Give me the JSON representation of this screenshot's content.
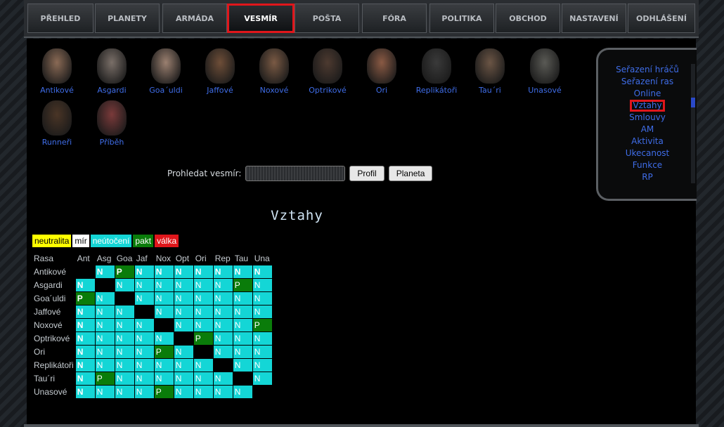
{
  "nav": {
    "items": [
      "PŘEHLED",
      "PLANETY",
      "ARMÁDA",
      "VESMÍR",
      "POŠTA",
      "FÓRA",
      "POLITIKA",
      "OBCHOD",
      "NASTAVENÍ",
      "ODHLÁŠENÍ"
    ],
    "active_index": 3
  },
  "races_row1": [
    "Antikové",
    "Asgardi",
    "Goa´uldi",
    "Jaffové",
    "Noxové",
    "Optrikové",
    "Ori",
    "Replikátoři",
    "Tau´ri",
    "Unasové"
  ],
  "races_row2": [
    "Runneři",
    "Příběh"
  ],
  "search": {
    "label": "Prohledat vesmír:",
    "profil": "Profil",
    "planeta": "Planeta"
  },
  "sidebar": {
    "links": [
      "Seřazení hráčů",
      "Seřazení ras",
      "Online",
      "Vztahy",
      "Smlouvy",
      "AM",
      "Aktivita",
      "Ukecanost",
      "Funkce",
      "RP"
    ],
    "active": "Vztahy"
  },
  "title": "Vztahy",
  "legend": [
    {
      "label": "neutralita",
      "bg": "#ffff00",
      "fg": "#000000"
    },
    {
      "label": "mír",
      "bg": "#ffffff",
      "fg": "#000000"
    },
    {
      "label": "neútočení",
      "bg": "#14d6d6",
      "fg": "#ffffff"
    },
    {
      "label": "pakt",
      "bg": "#0a7c0a",
      "fg": "#ffffff"
    },
    {
      "label": "válka",
      "bg": "#e0161b",
      "fg": "#ffffff"
    }
  ],
  "table": {
    "corner": "Rasa",
    "cols": [
      "Ant",
      "Asg",
      "Goa",
      "Jaf",
      "Nox",
      "Opt",
      "Ori",
      "Rep",
      "Tau",
      "Una"
    ],
    "rows": [
      {
        "name": "Antikové",
        "cells": [
          "",
          "N",
          "P",
          "N",
          "N",
          "N",
          "N",
          "N",
          "N",
          "N"
        ]
      },
      {
        "name": "Asgardi",
        "cells": [
          "N",
          "",
          "N",
          "N",
          "N",
          "N",
          "N",
          "N",
          "P",
          "N"
        ]
      },
      {
        "name": "Goa´uldi",
        "cells": [
          "P",
          "N",
          "",
          "N",
          "N",
          "N",
          "N",
          "N",
          "N",
          "N"
        ]
      },
      {
        "name": "Jaffové",
        "cells": [
          "N",
          "N",
          "N",
          "",
          "N",
          "N",
          "N",
          "N",
          "N",
          "N"
        ]
      },
      {
        "name": "Noxové",
        "cells": [
          "N",
          "N",
          "N",
          "N",
          "",
          "N",
          "N",
          "N",
          "N",
          "P"
        ]
      },
      {
        "name": "Optrikové",
        "cells": [
          "N",
          "N",
          "N",
          "N",
          "N",
          "",
          "P",
          "N",
          "N",
          "N"
        ]
      },
      {
        "name": "Ori",
        "cells": [
          "N",
          "N",
          "N",
          "N",
          "P",
          "N",
          "",
          "N",
          "N",
          "N"
        ]
      },
      {
        "name": "Replikátoři",
        "cells": [
          "N",
          "N",
          "N",
          "N",
          "N",
          "N",
          "N",
          "",
          "N",
          "N"
        ]
      },
      {
        "name": "Tau´ri",
        "cells": [
          "N",
          "P",
          "N",
          "N",
          "N",
          "N",
          "N",
          "N",
          "",
          "N"
        ]
      },
      {
        "name": "Unasové",
        "cells": [
          "N",
          "N",
          "N",
          "N",
          "P",
          "N",
          "N",
          "N",
          "N",
          ""
        ]
      }
    ]
  }
}
